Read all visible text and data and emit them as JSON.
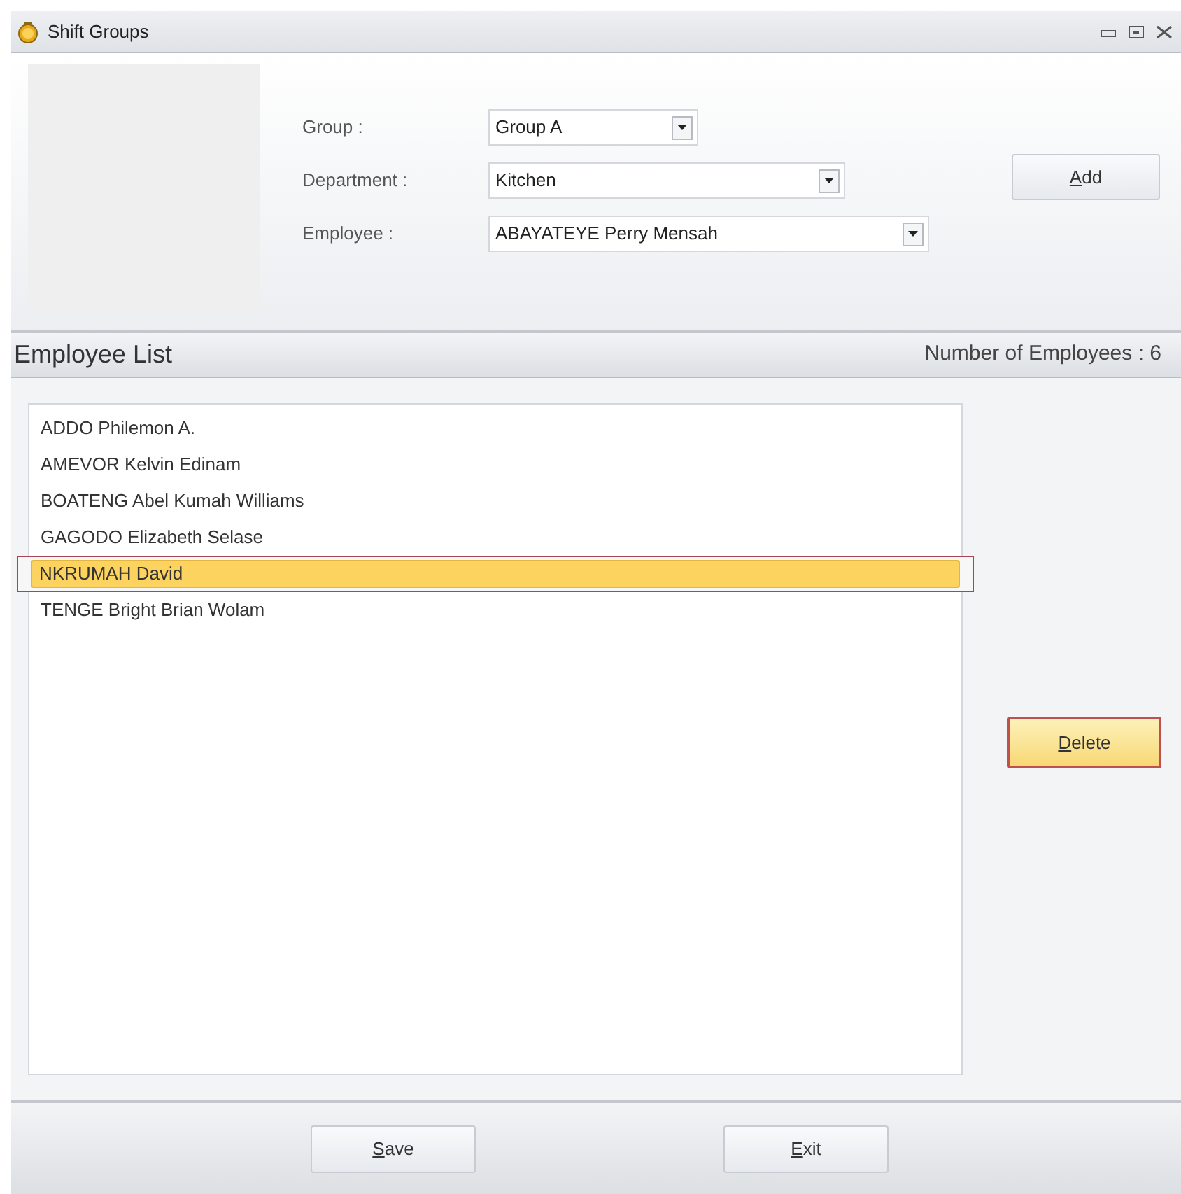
{
  "window": {
    "title": "Shift Groups"
  },
  "form": {
    "fields": [
      {
        "label": "Group :",
        "value": "Group A"
      },
      {
        "label": "Department :",
        "value": "Kitchen"
      },
      {
        "label": "Employee :",
        "value": "ABAYATEYE Perry Mensah"
      }
    ],
    "add_button": {
      "accel": "A",
      "rest": "dd"
    }
  },
  "employee_list": {
    "title": "Employee List",
    "count": "Number of Employees : 6",
    "items": [
      {
        "name": "ADDO Philemon A.",
        "selected": false
      },
      {
        "name": "AMEVOR Kelvin Edinam",
        "selected": false
      },
      {
        "name": "BOATENG Abel Kumah Williams",
        "selected": false
      },
      {
        "name": "GAGODO Elizabeth Selase",
        "selected": false
      },
      {
        "name": "NKRUMAH David",
        "selected": true
      },
      {
        "name": "TENGE Bright Brian Wolam",
        "selected": false
      }
    ],
    "delete_button": {
      "accel": "D",
      "rest": "elete",
      "focused": true
    }
  },
  "footer": {
    "buttons": [
      {
        "accel": "S",
        "rest": "ave"
      },
      {
        "accel": "E",
        "rest": "xit"
      }
    ]
  }
}
